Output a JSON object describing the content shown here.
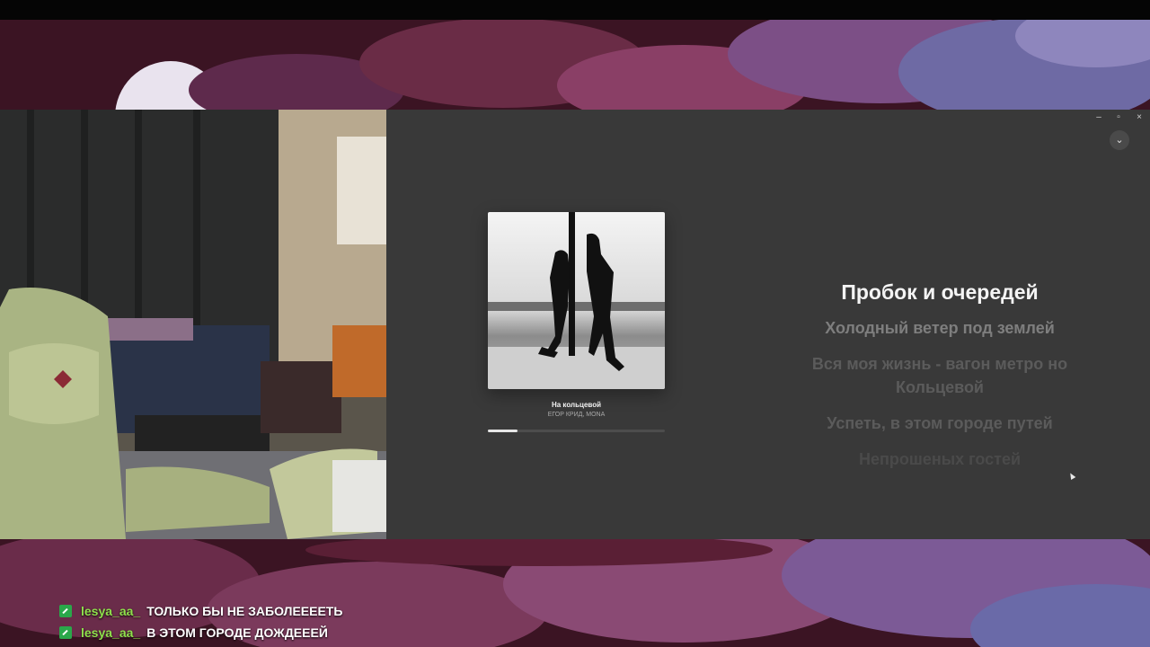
{
  "window": {
    "minimize_glyph": "–",
    "maximize_glyph": "▫",
    "close_glyph": "×"
  },
  "player": {
    "collapse_glyph": "⌄",
    "track_title": "На кольцевой",
    "track_artist": "ЕГОР КРИД, MONA",
    "progress_fraction": 0.17,
    "lyrics": [
      "Пробок и очередей",
      "Холодный ветер под землей",
      "Вся моя жизнь - вагон метро но Кольцевой",
      "Успеть, в этом городе путей",
      "Непрошеных гостей"
    ]
  },
  "chat": [
    {
      "username": "lesya_aa_",
      "message": "ТОЛЬКО БЫ НЕ ЗАБОЛЕЕЕЕТЬ"
    },
    {
      "username": "lesya_aa_",
      "message": "В ЭТОМ ГОРОДЕ ДОЖДЕЕЕЙ"
    }
  ],
  "colors": {
    "accent_chat_name": "#8fe04c",
    "badge": "#2aa84a",
    "player_bg": "#393939"
  }
}
